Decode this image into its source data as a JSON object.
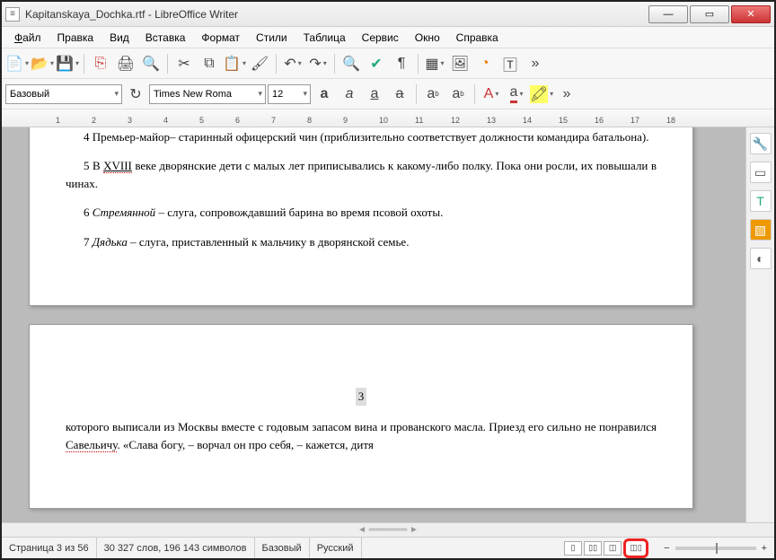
{
  "window": {
    "title": "Kapitanskaya_Dochka.rtf - LibreOffice Writer"
  },
  "menu": {
    "file": "Файл",
    "edit": "Правка",
    "view": "Вид",
    "insert": "Вставка",
    "format": "Формат",
    "styles": "Стили",
    "table": "Таблица",
    "tools": "Сервис",
    "window": "Окно",
    "help": "Справка"
  },
  "format_bar": {
    "para_style": "Базовый",
    "font_name": "Times New Roma",
    "font_size": "12"
  },
  "document": {
    "line4": "4 Премьер-майор– старинный офицерский чин (приблизительно соответствует должности командира батальона).",
    "line5a": "5 В ",
    "line5_under": "XVIII",
    "line5b": " веке дворянские дети с малых лет приписывались к какому-либо полку. Пока они росли, их повышали в чинах.",
    "line6a": "6 ",
    "line6_ital": "Стремянной",
    "line6b": " – слуга, сопровождавший барина во время псовой охоты.",
    "line7a": "7 ",
    "line7_ital": "Дядька",
    "line7b": " – слуга, приставленный к мальчику в дворянской семье.",
    "page_num": "3",
    "body2a": "которого выписали из Москвы вместе с годовым запасом вина и прованского масла. Приезд его сильно не понравился ",
    "body2_name": "Савельичу",
    "body2b": ". «Слава богу, – ворчал он про себя, – кажется, дитя"
  },
  "status": {
    "page": "Страница 3 из 56",
    "words": "30 327 слов, 196 143 символов",
    "style": "Базовый",
    "lang": "Русский"
  }
}
